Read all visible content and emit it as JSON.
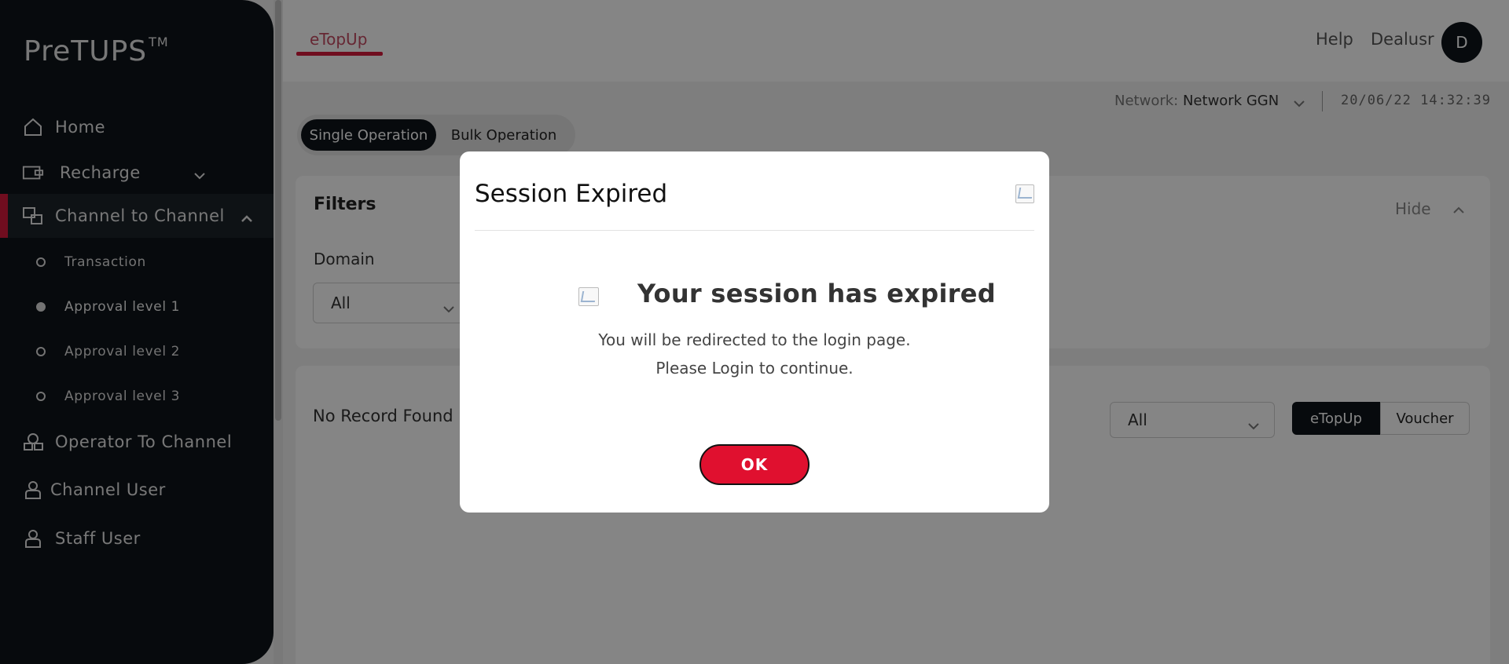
{
  "sidebar": {
    "logo": "PreTUPS",
    "logo_tm": "TM",
    "items": [
      {
        "label": "Home",
        "icon": "home-icon"
      },
      {
        "label": "Recharge",
        "icon": "recharge-icon"
      },
      {
        "label": "Channel to Channel",
        "icon": "channel-icon"
      },
      {
        "label": "Operator To Channel",
        "icon": "operator-icon"
      },
      {
        "label": "Channel User",
        "icon": "user-icon"
      },
      {
        "label": "Staff User",
        "icon": "user-icon"
      }
    ],
    "sub_items": [
      {
        "label": "Transaction"
      },
      {
        "label": "Approval level 1"
      },
      {
        "label": "Approval level 2"
      },
      {
        "label": "Approval level 3"
      }
    ]
  },
  "header": {
    "tab": "eTopUp",
    "help": "Help",
    "user_name": "Dealusr",
    "avatar_initial": "D",
    "network_label": "Network:",
    "network_value": "Network GGN",
    "datetime": "20/06/22 14:32:39"
  },
  "operation_toggle": {
    "single": "Single Operation",
    "bulk": "Bulk Operation"
  },
  "filters": {
    "title": "Filters",
    "hide": "Hide",
    "domain_label": "Domain",
    "domain_value": "All"
  },
  "results": {
    "empty_text": "No Record Found",
    "type_select_value": "All",
    "segment_on": "eTopUp",
    "segment_off": "Voucher"
  },
  "modal": {
    "title": "Session Expired",
    "heading": "Your session has expired",
    "message_line1": "You will be redirected to the login page.",
    "message_line2": "Please Login to continue.",
    "ok_label": "OK"
  },
  "colors": {
    "sidebar_bg": "#0f1419",
    "accent_red": "#d7193d",
    "ok_red": "#e0102f"
  }
}
